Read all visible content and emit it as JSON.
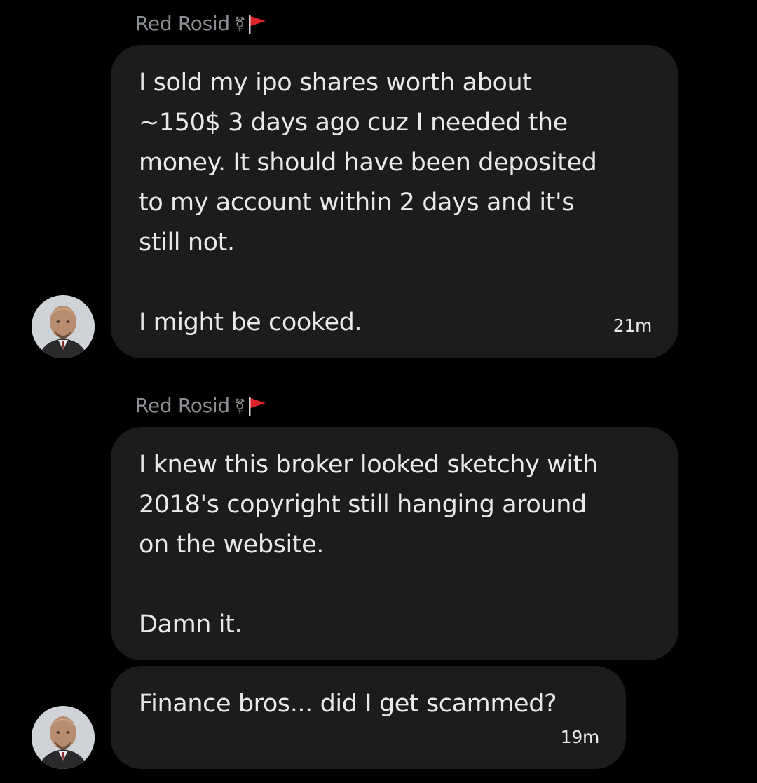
{
  "messages": [
    {
      "sender": "Red Rosid",
      "text": "I sold my ipo shares worth about\n~150$ 3 days ago cuz I needed the\nmoney. It should have been deposited\nto my account within 2 days and it's\nstill not.\n\nI might be cooked.",
      "time": "21m"
    },
    {
      "sender": "Red Rosid",
      "text": "I knew this broker looked sketchy with\n2018's copyright still hanging around\non the website.\n\nDamn it.",
      "time": ""
    },
    {
      "sender": "",
      "text": "Finance bros... did I get scammed?",
      "time": "19m"
    }
  ],
  "icons": {
    "gender": "⚧",
    "flag": "red-flag"
  },
  "colors": {
    "background": "#000000",
    "bubble": "#1c1c1e",
    "text": "#e7e9ea",
    "sender": "#8b8f94",
    "flag": "#e0242b"
  }
}
